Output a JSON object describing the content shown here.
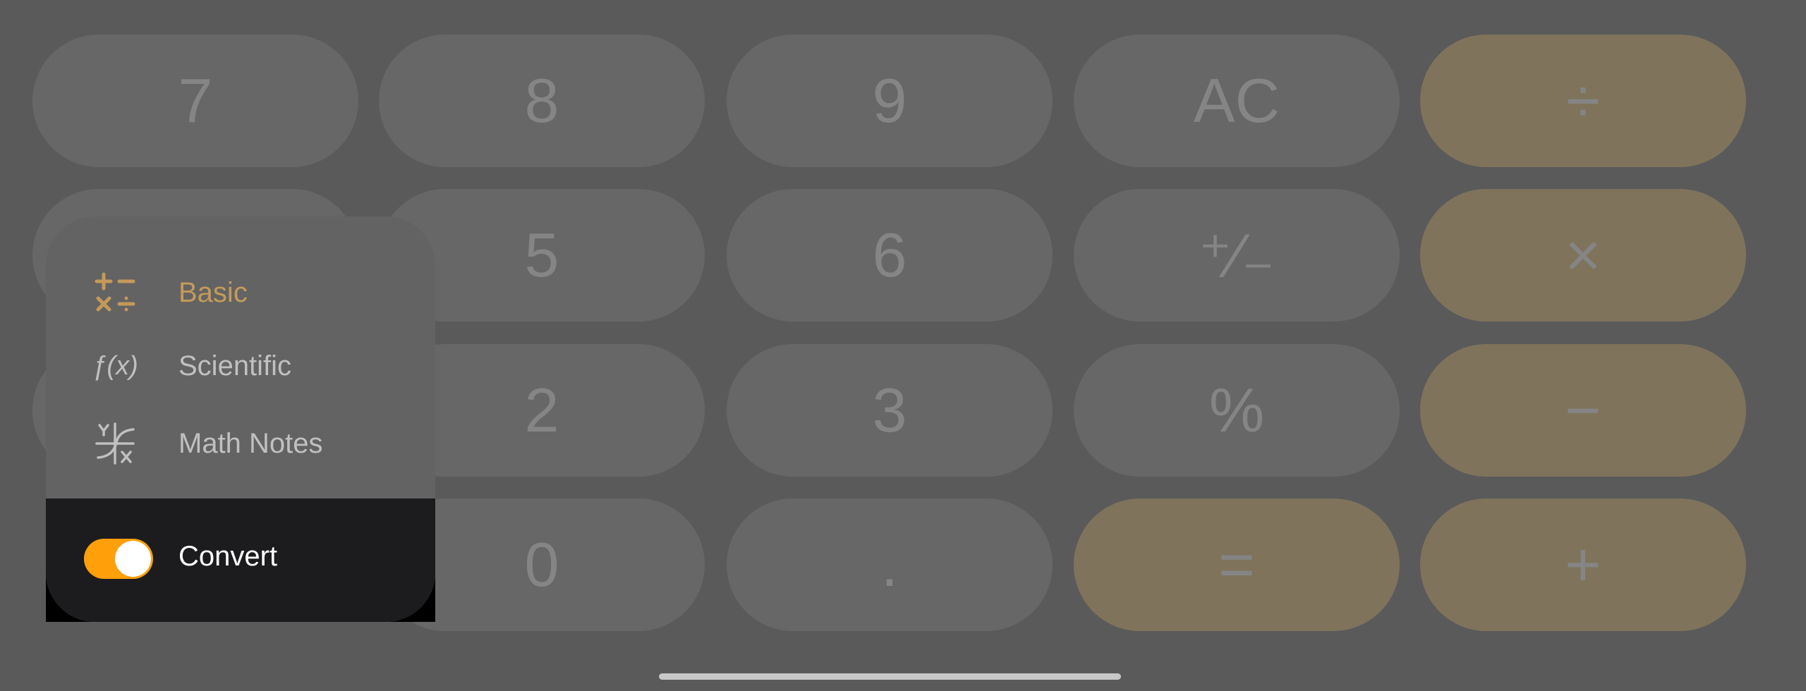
{
  "keypad": {
    "row1": [
      "7",
      "8",
      "9",
      "AC",
      "÷"
    ],
    "row2": [
      "",
      "5",
      "6",
      "⁺∕₋",
      "×"
    ],
    "row3": [
      "",
      "2",
      "3",
      "%",
      "−"
    ],
    "row4": [
      "",
      "0",
      ".",
      "=",
      "+"
    ]
  },
  "mode_menu": {
    "items": [
      {
        "label": "Basic",
        "icon": "plus-minus-times-divide-icon",
        "selected": true
      },
      {
        "label": "Scientific",
        "icon": "function-icon",
        "selected": false
      },
      {
        "label": "Math Notes",
        "icon": "graph-xy-icon",
        "selected": false
      }
    ],
    "convert": {
      "label": "Convert",
      "on": true
    }
  },
  "colors": {
    "accent": "#ff9f0a",
    "selected_text": "#c49a5a",
    "background": "#5a5a5a",
    "operator_key": "#7f735c",
    "key": "#676767"
  }
}
